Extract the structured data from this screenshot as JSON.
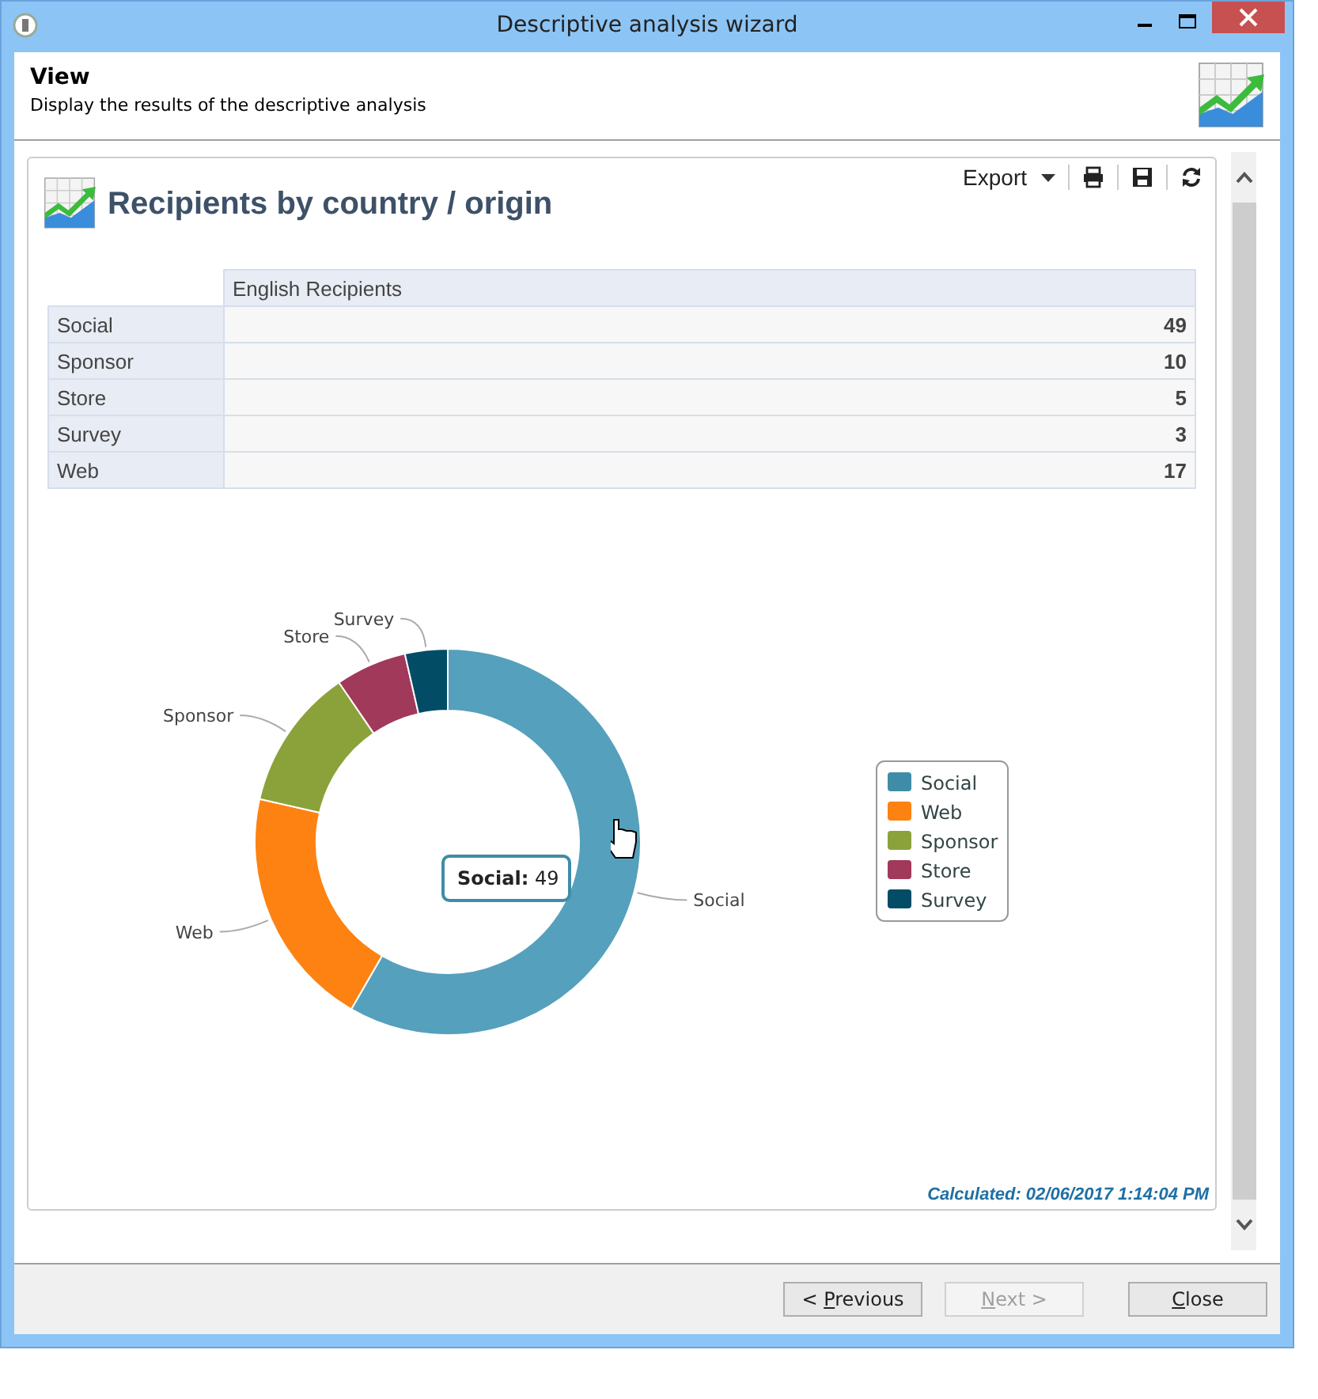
{
  "window": {
    "title": "Descriptive analysis wizard"
  },
  "header": {
    "title": "View",
    "subtitle": "Display the results of the descriptive analysis"
  },
  "report": {
    "title": "Recipients by country / origin",
    "export": "Export",
    "table": {
      "columns": [
        "English Recipients"
      ],
      "rows": [
        {
          "label": "Social",
          "value": "49"
        },
        {
          "label": "Sponsor",
          "value": "10"
        },
        {
          "label": "Store",
          "value": "5"
        },
        {
          "label": "Survey",
          "value": "3"
        },
        {
          "label": "Web",
          "value": "17"
        }
      ]
    },
    "chart_data": {
      "type": "donut",
      "categories": [
        "Social",
        "Web",
        "Sponsor",
        "Store",
        "Survey"
      ],
      "values": [
        58.33,
        20.24,
        11.9,
        5.96,
        3.57
      ],
      "colors": [
        "#55a0bc",
        "#fd8212",
        "#8ba23b",
        "#a1395b",
        "#034c66"
      ]
    },
    "tooltip": {
      "label": "Social:",
      "value": "49"
    },
    "legend": [
      {
        "label": "Social",
        "color": "#3f8ca8"
      },
      {
        "label": "Web",
        "color": "#fd8212"
      },
      {
        "label": "Sponsor",
        "color": "#8ba23b"
      },
      {
        "label": "Store",
        "color": "#a1395b"
      },
      {
        "label": "Survey",
        "color": "#034c66"
      }
    ],
    "calculated": "Calculated: 02/06/2017 1:14:04 PM"
  },
  "buttons": [
    {
      "before": "< ",
      "key": "P",
      "after": "revious",
      "disabled": false
    },
    {
      "key": "N",
      "after": "ext >",
      "disabled": true
    },
    {
      "key": "C",
      "after": "lose",
      "disabled": false
    }
  ]
}
